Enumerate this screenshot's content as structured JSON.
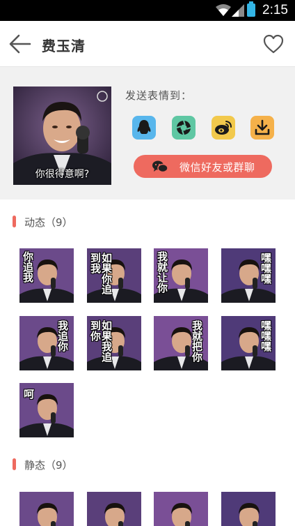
{
  "status_bar": {
    "time": "2:15"
  },
  "header": {
    "title": "费玉清"
  },
  "send_panel": {
    "preview_caption": "你很得意啊?",
    "send_to_label": "发送表情到：",
    "wechat_button_label": "微信好友或群聊"
  },
  "sections": {
    "animated": {
      "label": "动态（9）"
    },
    "static": {
      "label": "静态（9）"
    }
  },
  "animated_items": [
    {
      "caption": "你追我"
    },
    {
      "caption": "如果你追到我"
    },
    {
      "caption": "我就让你"
    },
    {
      "caption": "嘿嘿嘿"
    },
    {
      "caption": "我追你"
    },
    {
      "caption": "如果我追到你"
    },
    {
      "caption": "我就把你"
    },
    {
      "caption": "嘿嘿嘿"
    },
    {
      "caption": "呵"
    }
  ],
  "colors": {
    "accent": "#ee6a5f",
    "panel_bg": "#f1f1f1"
  },
  "icons": {
    "back": "arrow-left-icon",
    "favorite": "heart-outline-icon",
    "qq": "qq-penguin-icon",
    "moments": "camera-aperture-icon",
    "weibo": "weibo-icon",
    "download": "download-icon",
    "wechat": "wechat-icon"
  }
}
